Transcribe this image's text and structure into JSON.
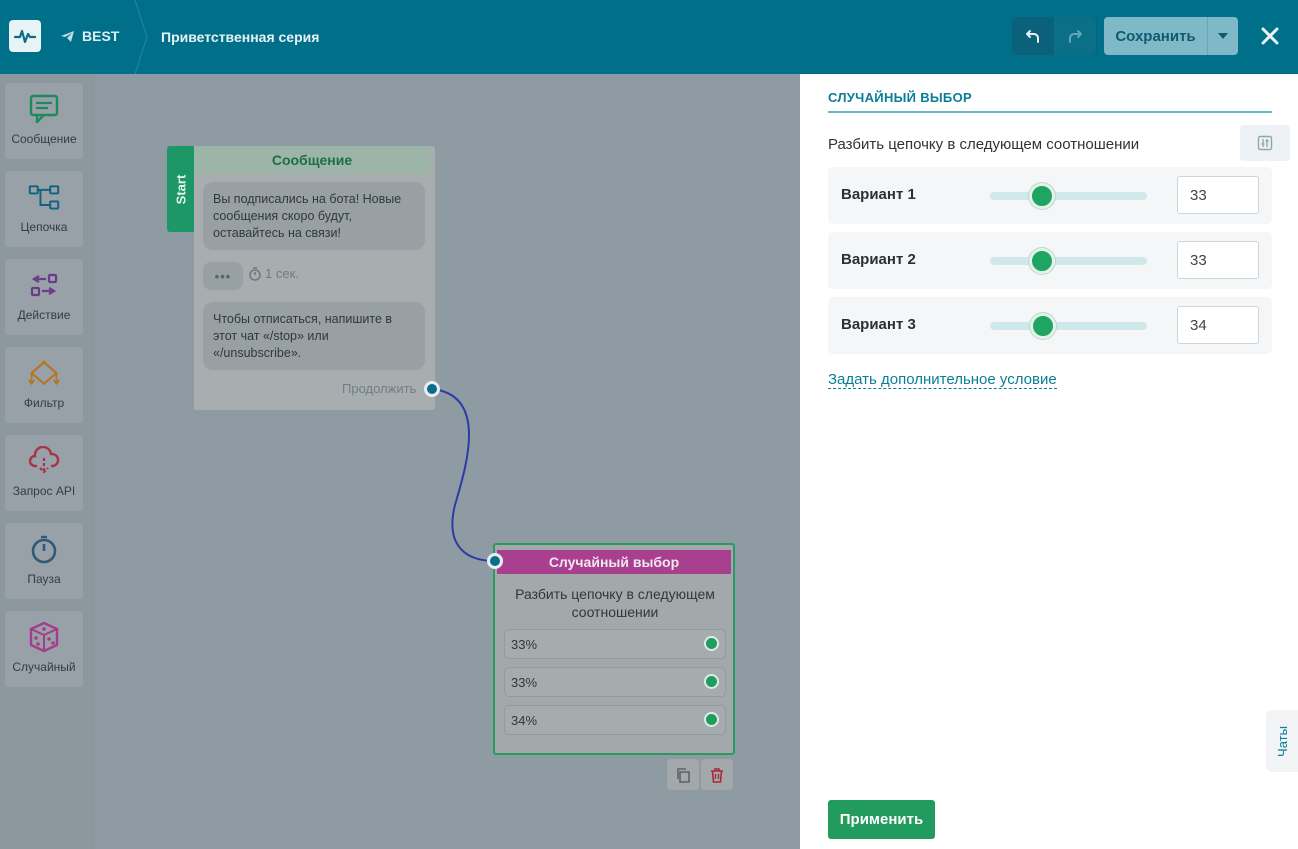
{
  "header": {
    "bot_name": "BEST",
    "page_title": "Приветственная серия",
    "save_label": "Сохранить",
    "icons": {
      "logo": "pulse-logo-icon",
      "bot": "telegram-icon",
      "undo": "undo-icon",
      "redo": "redo-icon",
      "save_menu": "caret-down-icon",
      "close": "close-icon"
    }
  },
  "sidebar": {
    "items": [
      {
        "label": "Сообщение",
        "icon": "message-icon",
        "color": "#1e8a5c"
      },
      {
        "label": "Цепочка",
        "icon": "chain-icon",
        "color": "#0e6480"
      },
      {
        "label": "Действие",
        "icon": "action-icon",
        "color": "#6b3c88"
      },
      {
        "label": "Фильтр",
        "icon": "filter-icon",
        "color": "#b77521"
      },
      {
        "label": "Запрос API",
        "icon": "api-request-icon",
        "color": "#a8334a"
      },
      {
        "label": "Пауза",
        "icon": "pause-timer-icon",
        "color": "#305a78"
      },
      {
        "label": "Случайный",
        "icon": "dice-icon",
        "color": "#a63b8e"
      }
    ]
  },
  "canvas": {
    "message_node": {
      "start_label": "Start",
      "title": "Сообщение",
      "bubble1": "Вы подписались на бота! Новые сообщения скоро будут, оставайтесь на связи!",
      "typing": "•••",
      "delay": "1 сек.",
      "bubble2": "Чтобы отписаться, напишите в этот чат «/stop» или «/unsubscribe».",
      "continue_label": "Продолжить"
    },
    "random_node": {
      "title": "Случайный выбор",
      "description": "Разбить цепочку в следующем соотношении",
      "rows": [
        "33%",
        "33%",
        "34%"
      ]
    }
  },
  "panel": {
    "title": "СЛУЧАЙНЫЙ ВЫБОР",
    "subtitle": "Разбить цепочку в следующем соотношении",
    "variants": [
      {
        "label": "Вариант 1",
        "value": "33",
        "level": 0.33
      },
      {
        "label": "Вариант 2",
        "value": "33",
        "level": 0.33
      },
      {
        "label": "Вариант 3",
        "value": "34",
        "level": 0.34
      }
    ],
    "add_condition": "Задать дополнительное условие",
    "apply_label": "Применить",
    "chats_label": "Чаты"
  },
  "colors": {
    "topbar": "#006f8a",
    "accent": "#0a7e97",
    "green": "#219b5e",
    "random": "#a83f8f"
  }
}
